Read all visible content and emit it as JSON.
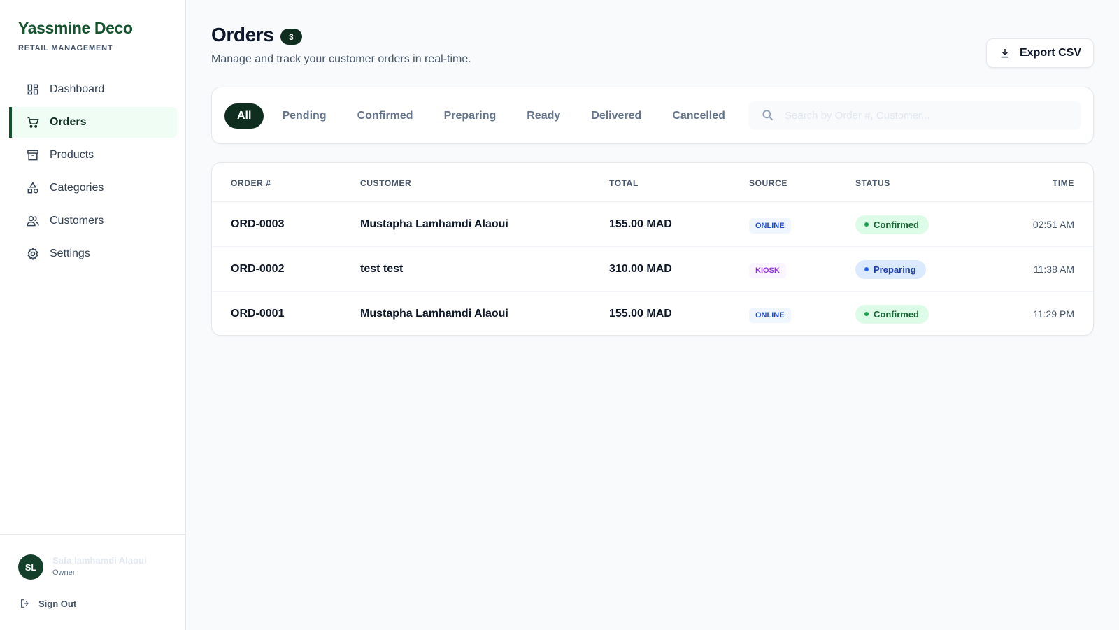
{
  "brand": {
    "title": "Yassmine Deco",
    "subtitle": "RETAIL MANAGEMENT"
  },
  "sidebar": {
    "items": [
      {
        "label": "Dashboard",
        "icon": "dashboard-icon"
      },
      {
        "label": "Orders",
        "icon": "cart-icon",
        "active": true
      },
      {
        "label": "Products",
        "icon": "archive-box-icon"
      },
      {
        "label": "Categories",
        "icon": "shapes-icon"
      },
      {
        "label": "Customers",
        "icon": "users-icon"
      },
      {
        "label": "Settings",
        "icon": "gear-icon"
      }
    ]
  },
  "user": {
    "initials": "SL",
    "name": "Safa lamhamdi Alaoui",
    "role": "Owner",
    "signout_label": "Sign Out"
  },
  "header": {
    "title": "Orders",
    "count": "3",
    "subtitle": "Manage and track your customer orders in real-time.",
    "export_label": "Export CSV"
  },
  "filters": {
    "tabs": [
      "All",
      "Pending",
      "Confirmed",
      "Preparing",
      "Ready",
      "Delivered",
      "Cancelled"
    ],
    "active": "All",
    "search_placeholder": "Search by Order #, Customer..."
  },
  "table": {
    "columns": {
      "order": "ORDER #",
      "customer": "CUSTOMER",
      "total": "TOTAL",
      "source": "SOURCE",
      "status": "STATUS",
      "time": "TIME"
    },
    "rows": [
      {
        "order": "ORD-0003",
        "customer": "Mustapha Lamhamdi Alaoui",
        "total": "155.00 MAD",
        "source": "ONLINE",
        "status": "Confirmed",
        "time": "02:51 AM"
      },
      {
        "order": "ORD-0002",
        "customer": "test test",
        "total": "310.00 MAD",
        "source": "KIOSK",
        "status": "Preparing",
        "time": "11:38 AM"
      },
      {
        "order": "ORD-0001",
        "customer": "Mustapha Lamhamdi Alaoui",
        "total": "155.00 MAD",
        "source": "ONLINE",
        "status": "Confirmed",
        "time": "11:29 PM"
      }
    ]
  },
  "colors": {
    "brand": "#14532d",
    "active_dark": "#0f2e1f",
    "confirmed": "#16a34a",
    "preparing": "#2563eb",
    "online": "#1d4ed8",
    "kiosk": "#9333ea"
  }
}
